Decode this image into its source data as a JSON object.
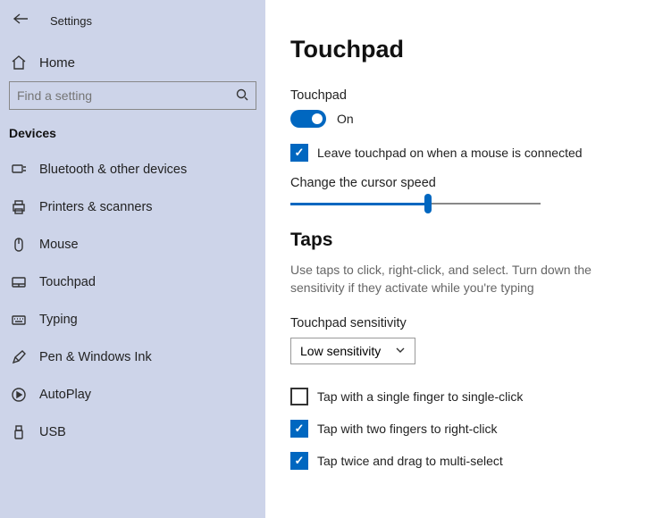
{
  "header": {
    "title": "Settings"
  },
  "home": {
    "label": "Home"
  },
  "search": {
    "placeholder": "Find a setting"
  },
  "section": {
    "label": "Devices"
  },
  "nav": [
    {
      "label": "Bluetooth & other devices"
    },
    {
      "label": "Printers & scanners"
    },
    {
      "label": "Mouse"
    },
    {
      "label": "Touchpad"
    },
    {
      "label": "Typing"
    },
    {
      "label": "Pen & Windows Ink"
    },
    {
      "label": "AutoPlay"
    },
    {
      "label": "USB"
    }
  ],
  "main": {
    "title": "Touchpad",
    "touchpad_label": "Touchpad",
    "toggle_state": "On",
    "leave_on_label": "Leave touchpad on when a mouse is connected",
    "cursor_speed_label": "Change the cursor speed",
    "taps_title": "Taps",
    "taps_desc": "Use taps to click, right-click, and select. Turn down the sensitivity if they activate while you're typing",
    "sensitivity_label": "Touchpad sensitivity",
    "sensitivity_value": "Low sensitivity",
    "tap_single": "Tap with a single finger to single-click",
    "tap_two": "Tap with two fingers to right-click",
    "tap_twice": "Tap twice and drag to multi-select"
  }
}
